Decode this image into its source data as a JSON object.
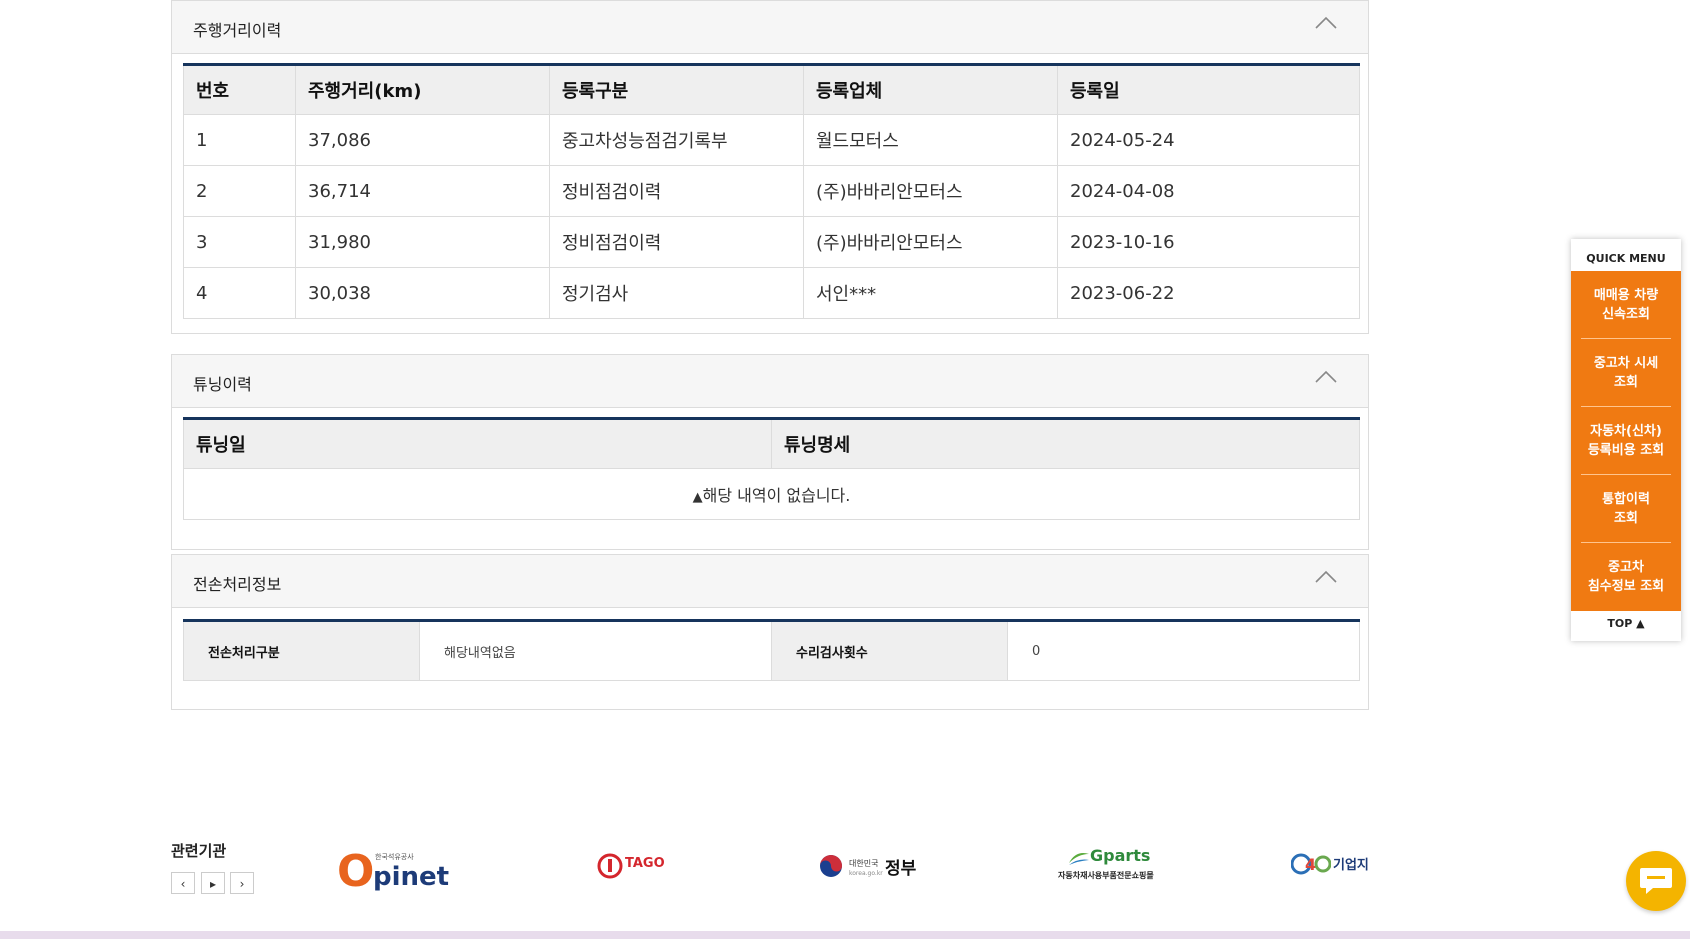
{
  "mileage": {
    "title": "주행거리이력",
    "headers": [
      "번호",
      "주행거리(km)",
      "등록구분",
      "등록업체",
      "등록일"
    ],
    "rows": [
      [
        "1",
        "37,086",
        "중고차성능점검기록부",
        "월드모터스",
        "2024-05-24"
      ],
      [
        "2",
        "36,714",
        "정비점검이력",
        "(주)바바리안모터스",
        "2024-04-08"
      ],
      [
        "3",
        "31,980",
        "정비점검이력",
        "(주)바바리안모터스",
        "2023-10-16"
      ],
      [
        "4",
        "30,038",
        "정기검사",
        "서인***",
        "2023-06-22"
      ]
    ]
  },
  "tuning": {
    "title": "튜닝이력",
    "headers": [
      "튜닝일",
      "튜닝명세"
    ],
    "empty_icon": "▲",
    "empty_text": "해당 내역이 없습니다."
  },
  "total_loss": {
    "title": "전손처리정보",
    "label1": "전손처리구분",
    "value1": "해당내역없음",
    "label2": "수리검사횟수",
    "value2": "0"
  },
  "quick_menu": {
    "title": "QUICK MENU",
    "items": [
      {
        "line1": "매매용 차량",
        "line2": "신속조회"
      },
      {
        "line1": "중고차 시세",
        "line2": "조회"
      },
      {
        "line1": "자동차(신차)",
        "line2": "등록비용 조회"
      },
      {
        "line1": "통합이력",
        "line2": "조회"
      },
      {
        "line1": "중고차",
        "line2": "침수정보 조회"
      }
    ],
    "top_label": "TOP ▲"
  },
  "related": {
    "label": "관련기관",
    "prev": "‹",
    "play": "▸",
    "next": "›",
    "logos": {
      "opinet_small": "한국석유공사",
      "opinet": "pinet",
      "tago": "TAGO",
      "gov_small": "대한민국",
      "gov": "정부",
      "gov_sub": "korea.go.kr",
      "gparts": "Gparts",
      "gparts_sub": "자동차재사용부품전문쇼핑몰",
      "g4b": "기업지원"
    }
  },
  "colors": {
    "accent_orange": "#f07a12",
    "table_top_border": "#16345c",
    "chat_yellow": "#f4b400"
  }
}
